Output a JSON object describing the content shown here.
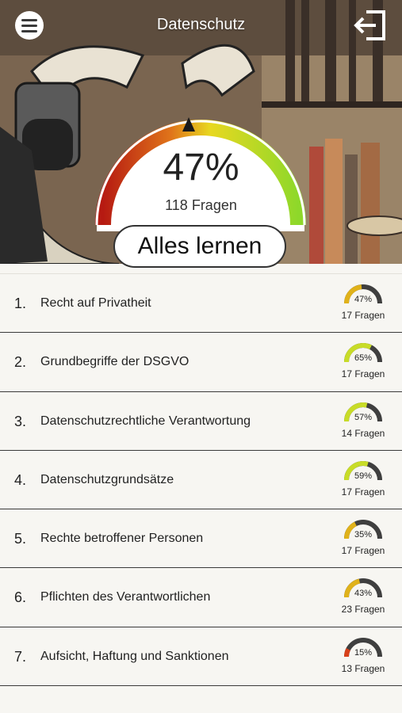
{
  "header": {
    "title": "Datenschutz"
  },
  "summary": {
    "percent_label": "47%",
    "percent": 47,
    "questions_label": "118 Fragen",
    "learn_button": "Alles lernen"
  },
  "colors": {
    "gauge_track": "#3f3f3f",
    "low": "#d8401a",
    "mid": "#e0b21a",
    "high": "#c8dc28"
  },
  "topics": [
    {
      "number": "1.",
      "title": "Recht auf Privatheit",
      "percent_label": "47%",
      "percent": 47,
      "questions": "17 Fragen"
    },
    {
      "number": "2.",
      "title": "Grundbegriffe der DSGVO",
      "percent_label": "65%",
      "percent": 65,
      "questions": "17 Fragen"
    },
    {
      "number": "3.",
      "title": "Datenschutzrechtliche Verantwortung",
      "percent_label": "57%",
      "percent": 57,
      "questions": "14 Fragen"
    },
    {
      "number": "4.",
      "title": "Datenschutzgrundsätze",
      "percent_label": "59%",
      "percent": 59,
      "questions": "17 Fragen"
    },
    {
      "number": "5.",
      "title": "Rechte betroffener Personen",
      "percent_label": "35%",
      "percent": 35,
      "questions": "17 Fragen"
    },
    {
      "number": "6.",
      "title": "Pflichten des Verantwortlichen",
      "percent_label": "43%",
      "percent": 43,
      "questions": "23 Fragen"
    },
    {
      "number": "7.",
      "title": "Aufsicht, Haftung und Sanktionen",
      "percent_label": "15%",
      "percent": 15,
      "questions": "13 Fragen"
    }
  ]
}
